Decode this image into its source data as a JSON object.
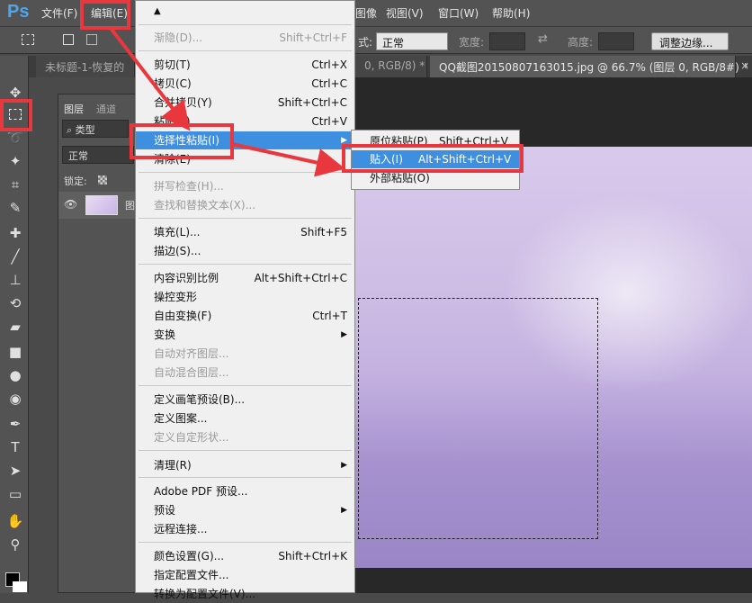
{
  "app": {
    "logo": "Ps"
  },
  "menubar": {
    "items": [
      "文件(F)",
      "编辑(E)",
      "图像",
      "视图(V)",
      "窗口(W)",
      "帮助(H)"
    ]
  },
  "options": {
    "style_label": "式:",
    "style_value": "正常",
    "width_label": "宽度:",
    "height_label": "高度:",
    "adjust_edge": "调整边缘..."
  },
  "tabs": [
    {
      "label": "未标题-1-恢复的"
    },
    {
      "label": "0, RGB/8) *"
    },
    {
      "label": "QQ截图20150807163015.jpg @ 66.7% (图层 0, RGB/8#) *"
    }
  ],
  "layers_panel": {
    "tab_layers": "图层",
    "tab_channels": "通道",
    "filter": "类型",
    "blend": "正常",
    "lock": "锁定:",
    "layer_name": "图"
  },
  "edit_menu": {
    "items": [
      {
        "label": "▲",
        "shortcut": ""
      },
      {
        "label": "渐隐(D)...",
        "shortcut": "Shift+Ctrl+F",
        "disabled": true
      },
      {
        "label": "剪切(T)",
        "shortcut": "Ctrl+X"
      },
      {
        "label": "拷贝(C)",
        "shortcut": "Ctrl+C"
      },
      {
        "label": "合并拷贝(Y)",
        "shortcut": "Shift+Ctrl+C"
      },
      {
        "label": "粘贴(P)",
        "shortcut": "Ctrl+V"
      },
      {
        "label": "选择性粘贴(I)",
        "shortcut": ""
      },
      {
        "label": "清除(E)",
        "shortcut": ""
      },
      {
        "label": "拼写检查(H)...",
        "shortcut": "",
        "disabled": true
      },
      {
        "label": "查找和替换文本(X)...",
        "shortcut": "",
        "disabled": true
      },
      {
        "label": "填充(L)...",
        "shortcut": "Shift+F5"
      },
      {
        "label": "描边(S)...",
        "shortcut": ""
      },
      {
        "label": "内容识别比例",
        "shortcut": "Alt+Shift+Ctrl+C"
      },
      {
        "label": "操控变形",
        "shortcut": ""
      },
      {
        "label": "自由变换(F)",
        "shortcut": "Ctrl+T"
      },
      {
        "label": "变换",
        "shortcut": ""
      },
      {
        "label": "自动对齐图层...",
        "shortcut": "",
        "disabled": true
      },
      {
        "label": "自动混合图层...",
        "shortcut": "",
        "disabled": true
      },
      {
        "label": "定义画笔预设(B)...",
        "shortcut": ""
      },
      {
        "label": "定义图案...",
        "shortcut": ""
      },
      {
        "label": "定义自定形状...",
        "shortcut": "",
        "disabled": true
      },
      {
        "label": "清理(R)",
        "shortcut": ""
      },
      {
        "label": "Adobe PDF 预设...",
        "shortcut": ""
      },
      {
        "label": "预设",
        "shortcut": ""
      },
      {
        "label": "远程连接...",
        "shortcut": ""
      },
      {
        "label": "颜色设置(G)...",
        "shortcut": "Shift+Ctrl+K"
      },
      {
        "label": "指定配置文件...",
        "shortcut": ""
      },
      {
        "label": "转换为配置文件(V)...",
        "shortcut": ""
      }
    ]
  },
  "submenu": {
    "items": [
      {
        "label": "原位粘贴(P)",
        "shortcut": "Shift+Ctrl+V"
      },
      {
        "label": "贴入(I)",
        "shortcut": "Alt+Shift+Ctrl+V"
      },
      {
        "label": "外部粘贴(O)",
        "shortcut": ""
      }
    ]
  },
  "colors": {
    "highlight": "#3f8fe0",
    "annotation": "#e8383d",
    "menu_bg": "#f0f0f0"
  }
}
